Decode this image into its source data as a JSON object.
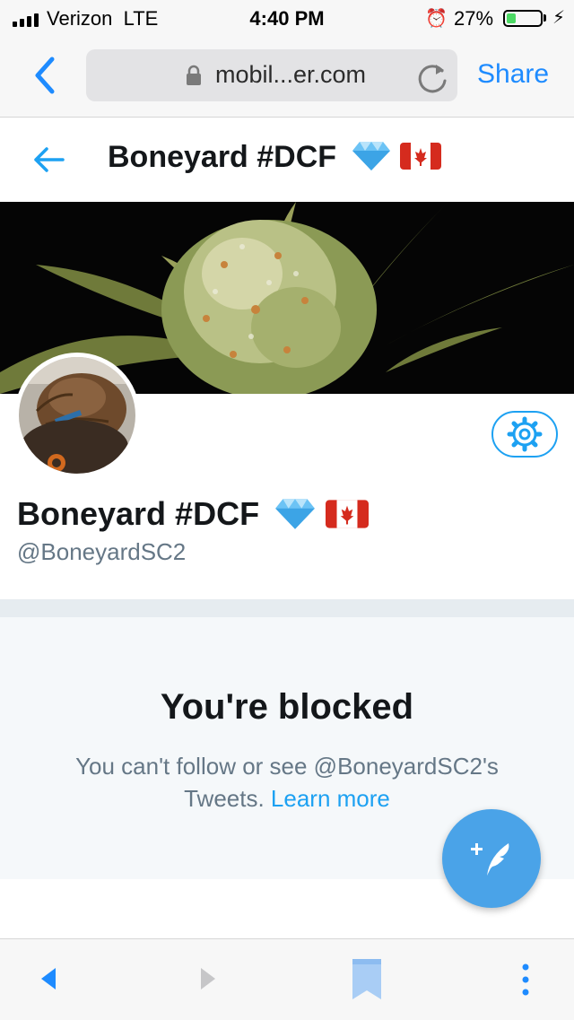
{
  "status_bar": {
    "carrier": "Verizon",
    "network": "LTE",
    "time": "4:40 PM",
    "battery_percent_label": "27%",
    "battery_level": 0.27,
    "icons": [
      "signal-icon",
      "alarm-icon",
      "battery-icon",
      "charging-bolt-icon"
    ]
  },
  "browser": {
    "url_display": "mobil...er.com",
    "share_label": "Share",
    "icons": [
      "back-chevron-icon",
      "lock-icon",
      "reload-icon"
    ]
  },
  "header": {
    "title": "Boneyard #DCF",
    "emojis": [
      "gem-emoji",
      "canada-flag-emoji"
    ]
  },
  "profile": {
    "name": "Boneyard #DCF",
    "handle": "@BoneyardSC2"
  },
  "blocked": {
    "title": "You're blocked",
    "message": "You can't follow or see @BoneyardSC2's Tweets.",
    "learn_more": "Learn more"
  },
  "fab": {
    "icon": "compose-tweet-icon"
  },
  "toolbar": {
    "icons": [
      "back-arrow-icon",
      "forward-arrow-icon",
      "bookmark-icon",
      "more-icon"
    ]
  },
  "colors": {
    "twitter_blue": "#1da1f2",
    "ios_blue": "#1e8bff",
    "battery_green": "#4cd964",
    "muted_text": "#657786"
  }
}
